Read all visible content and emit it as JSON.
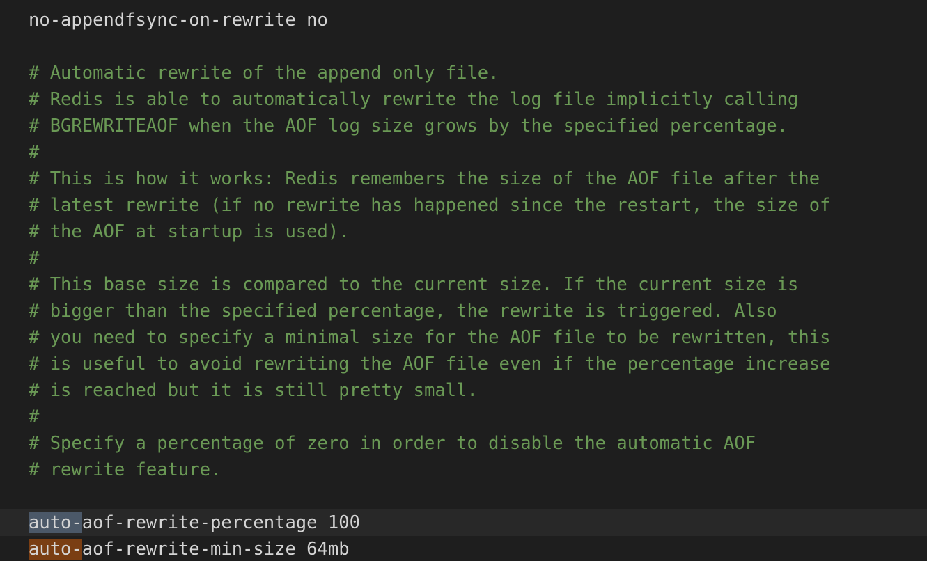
{
  "editor": {
    "lines": [
      {
        "kind": "code",
        "text": "no-appendfsync-on-rewrite no"
      },
      {
        "kind": "blank",
        "text": ""
      },
      {
        "kind": "comment",
        "text": "# Automatic rewrite of the append only file."
      },
      {
        "kind": "comment",
        "text": "# Redis is able to automatically rewrite the log file implicitly calling"
      },
      {
        "kind": "comment",
        "text": "# BGREWRITEAOF when the AOF log size grows by the specified percentage."
      },
      {
        "kind": "comment",
        "text": "#"
      },
      {
        "kind": "comment",
        "text": "# This is how it works: Redis remembers the size of the AOF file after the"
      },
      {
        "kind": "comment",
        "text": "# latest rewrite (if no rewrite has happened since the restart, the size of"
      },
      {
        "kind": "comment",
        "text": "# the AOF at startup is used)."
      },
      {
        "kind": "comment",
        "text": "#"
      },
      {
        "kind": "comment",
        "text": "# This base size is compared to the current size. If the current size is"
      },
      {
        "kind": "comment",
        "text": "# bigger than the specified percentage, the rewrite is triggered. Also"
      },
      {
        "kind": "comment",
        "text": "# you need to specify a minimal size for the AOF file to be rewritten, this"
      },
      {
        "kind": "comment",
        "text": "# is useful to avoid rewriting the AOF file even if the percentage increase"
      },
      {
        "kind": "comment",
        "text": "# is reached but it is still pretty small."
      },
      {
        "kind": "comment",
        "text": "#"
      },
      {
        "kind": "comment",
        "text": "# Specify a percentage of zero in order to disable the automatic AOF"
      },
      {
        "kind": "comment",
        "text": "# rewrite feature."
      },
      {
        "kind": "blank",
        "text": ""
      }
    ],
    "highlighted_lines": [
      {
        "highlight": "auto-",
        "rest": "aof-rewrite-percentage 100"
      },
      {
        "highlight": "auto-",
        "rest": "aof-rewrite-min-size 64mb"
      }
    ],
    "colors": {
      "background": "#1e1e1e",
      "code": "#d4d4d4",
      "comment": "#6a9955",
      "selection": "#4b5868",
      "find_match": "#7a3e13",
      "current_line": "#282828"
    }
  }
}
